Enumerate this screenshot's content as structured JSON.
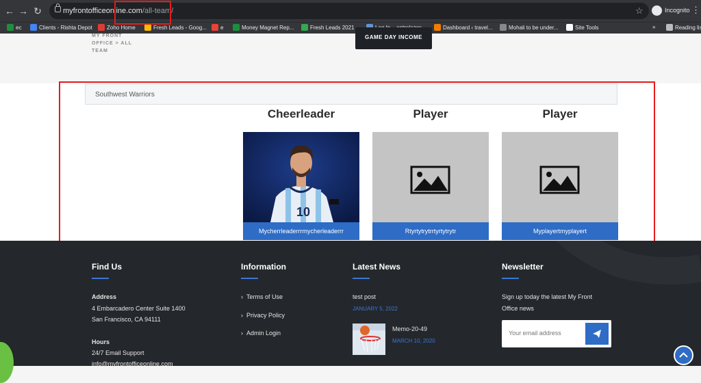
{
  "browser": {
    "url_host": "myfrontofficeonline.com",
    "url_path": "/all-team/",
    "incognito_label": "Incognito",
    "bookmarks": [
      {
        "label": "ec",
        "color": "#1e8e3e"
      },
      {
        "label": "Clients - Rishta Depot",
        "color": "#4285f4"
      },
      {
        "label": "Zoho Home",
        "color": "#e03b32"
      },
      {
        "label": "Fresh Leads - Goog...",
        "color": "#fbbc05"
      },
      {
        "label": "e",
        "color": "#ea4335"
      },
      {
        "label": "Money Magnet Rep...",
        "color": "#1e8e3e"
      },
      {
        "label": "Fresh Leads 2021 -...",
        "color": "#34a853"
      },
      {
        "label": "Log In – entrelazos...",
        "color": "#5f95d6"
      },
      {
        "label": "Dashboard ‹ travel...",
        "color": "#f57c00"
      },
      {
        "label": "Mohali to be under...",
        "color": "#888888"
      },
      {
        "label": "Site Tools",
        "color": "#ffffff"
      }
    ],
    "reading_list_label": "Reading lis"
  },
  "page": {
    "breadcrumb_line1": "MY FRONT",
    "breadcrumb_line2": "OFFICE > ALL",
    "breadcrumb_line3": "TEAM",
    "game_day_button": "GAME DAY INCOME",
    "team_name": "Southwest Warriors",
    "members": [
      {
        "role": "Cheerleader",
        "name": "Mycherrleaderrrmycherleaderrr",
        "has_photo": true
      },
      {
        "role": "Player",
        "name": "Rtyrtytrytrrtyrtytrytr",
        "has_photo": false
      },
      {
        "role": "Player",
        "name": "Myplayertmyplayert",
        "has_photo": false
      }
    ]
  },
  "footer": {
    "find_us": {
      "heading": "Find Us",
      "address_label": "Address",
      "address_line1": "4 Embarcadero Center Suite 1400",
      "address_line2": "San Francisco, CA 94111",
      "hours_label": "Hours",
      "hours_value": "24/7 Email Support",
      "email": "info@myfrontofficeonline.com"
    },
    "information": {
      "heading": "Information",
      "links": [
        "Terms of Use",
        "Privacy Policy",
        "Admin Login"
      ]
    },
    "latest_news": {
      "heading": "Latest News",
      "items": [
        {
          "title": "test post",
          "date": "JANUARY 5, 2022"
        },
        {
          "title": "Memo-20-49",
          "date": "MARCH 10, 2020"
        }
      ]
    },
    "newsletter": {
      "heading": "Newsletter",
      "text_line1": "Sign up today the latest My Front",
      "text_line2": "Office news",
      "email_placeholder": "Your email address"
    }
  },
  "colors": {
    "accent_blue": "#2e6cc6",
    "footer_bg": "#24272b",
    "annotation_red": "#e41b1b"
  }
}
